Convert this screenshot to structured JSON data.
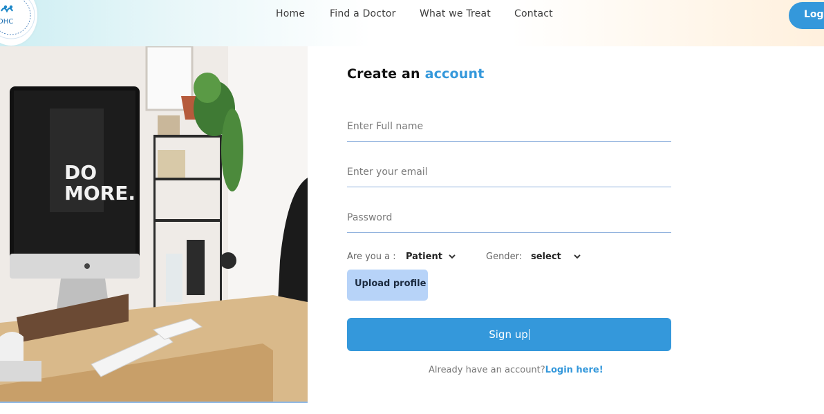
{
  "header": {
    "logo_text": "DHC",
    "nav": [
      "Home",
      "Find a Doctor",
      "What we Treat",
      "Contact"
    ],
    "login_label": "Logi"
  },
  "photo": {
    "monitor_text_line1": "DO",
    "monitor_text_line2": "MORE."
  },
  "form": {
    "title_prefix": "Create an ",
    "title_accent": "account",
    "name_placeholder": "Enter Full name",
    "email_placeholder": "Enter your email",
    "password_placeholder": "Password",
    "role_label": "Are you a :",
    "role_value": "Patient",
    "gender_label": "Gender:",
    "gender_value": "select",
    "upload_label": "Upload profile",
    "signup_label": "Sign up",
    "footer_text": "Already have an account?",
    "footer_link": "Login here!"
  },
  "colors": {
    "accent": "#3498db",
    "upload_bg": "#b7d3f8",
    "underline": "#8fb1dd"
  }
}
